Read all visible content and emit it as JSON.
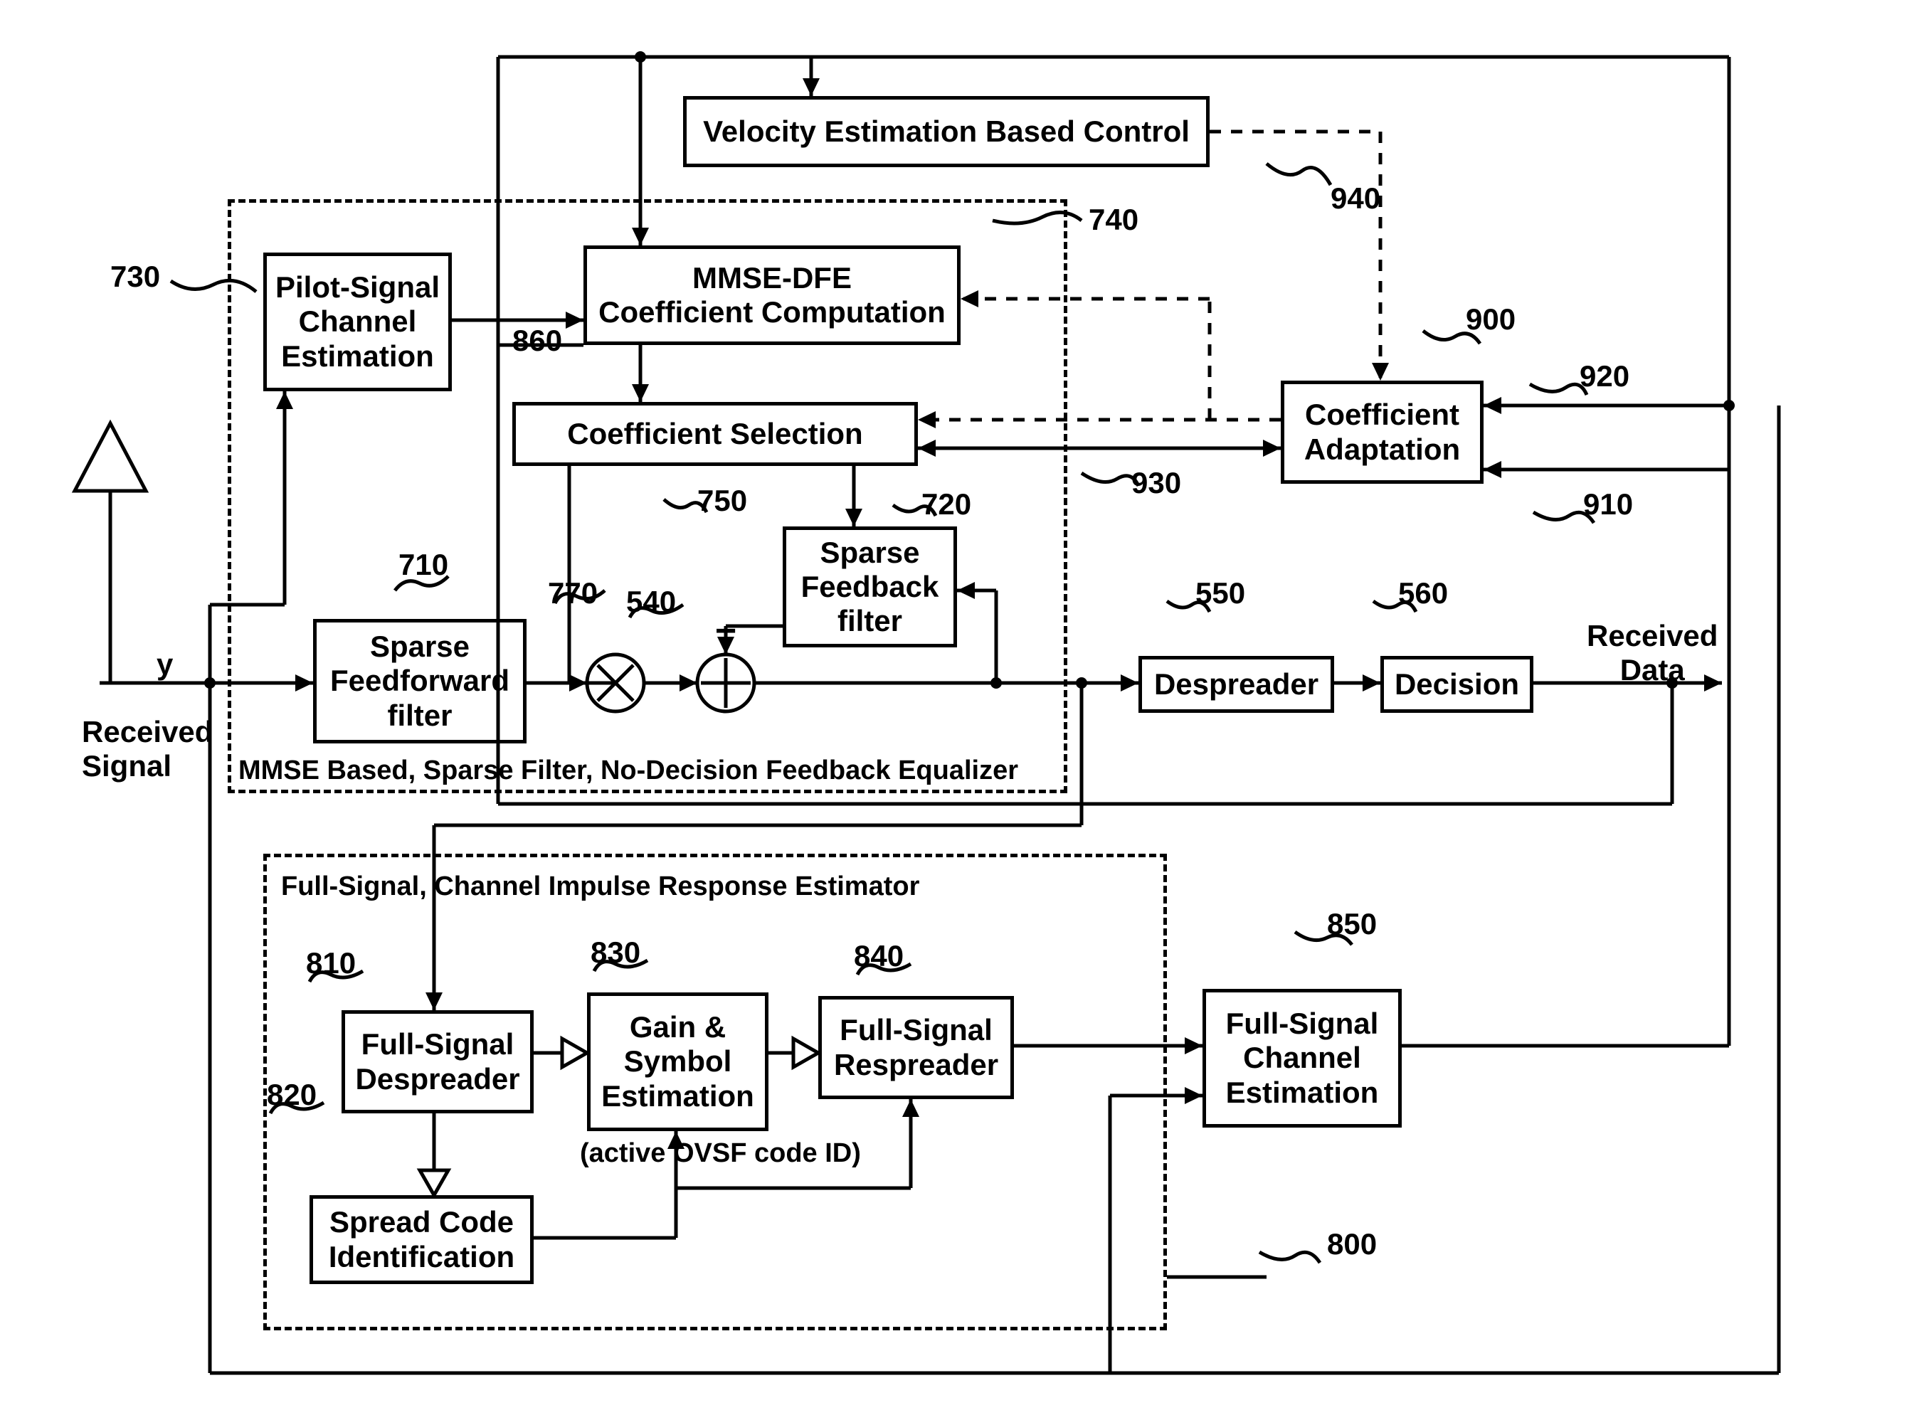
{
  "blocks": {
    "velocity": "Velocity Estimation Based Control",
    "pilot": "Pilot-Signal\nChannel\nEstimation",
    "mmse": "MMSE-DFE\nCoefficient  Computation",
    "coeffSel": "Coefficient Selection",
    "coeffAdapt": "Coefficient\nAdaptation",
    "sparseFb": "Sparse\nFeedback\nfilter",
    "sparseFf": "Sparse\nFeedforward\nfilter",
    "despreader": "Despreader",
    "decision": "Decision",
    "fullDespr": "Full-Signal\nDespreader",
    "gainSym": "Gain &\nSymbol\nEstimation",
    "fullRespr": "Full-Signal\nRespreader",
    "fullChan": "Full-Signal\nChannel\nEstimation",
    "spreadCode": "Spread Code\nIdentification"
  },
  "labels": {
    "recvSig": "Received\nSignal",
    "recvData": "Received\nData",
    "y": "y",
    "minus": "−",
    "ovsf": "(active OVSF code ID)",
    "mmseCap": "MMSE Based, Sparse Filter, No-Decision Feedback Equalizer",
    "fullCap": "Full-Signal, Channel Impulse Response Estimator"
  },
  "refs": {
    "r730": "730",
    "r940": "940",
    "r740": "740",
    "r860": "860",
    "r900": "900",
    "r920": "920",
    "r930": "930",
    "r910": "910",
    "r710": "710",
    "r770": "770",
    "r540": "540",
    "r720": "720",
    "r750": "750",
    "r550": "550",
    "r560": "560",
    "r810": "810",
    "r820": "820",
    "r830": "830",
    "r840": "840",
    "r850": "850",
    "r800": "800"
  }
}
